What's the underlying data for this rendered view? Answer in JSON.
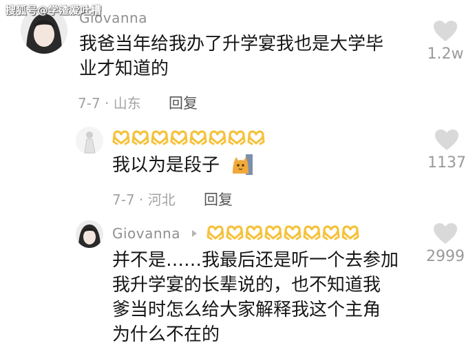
{
  "watermark": "搜狐号@学渣爱吐槽",
  "comments": [
    {
      "username": "Giovanna",
      "lines": [
        "我爸当年给我办了升学宴我也是大学毕",
        "业才知道的"
      ],
      "meta": "7-7 · 山东",
      "reply_label": "回复",
      "like_count": "1.2w",
      "like_icon": "heart-icon"
    },
    {
      "emoji": "heart-hands",
      "emoji_count": 8,
      "lines": [
        "我以为是段子"
      ],
      "sticker": "cat-sticker",
      "meta": "7-7 · 河北",
      "reply_label": "回复",
      "like_count": "1137",
      "like_icon": "heart-icon"
    },
    {
      "username": "Giovanna",
      "emoji": "heart-hands",
      "emoji_count": 8,
      "lines": [
        "并不是……我最后还是听一个去参加",
        "我升学宴的长辈说的，也不知道我",
        "爹当时怎么给大家解释我这个主角",
        "为什么不在的"
      ],
      "like_count": "2999",
      "like_icon": "heart-icon"
    }
  ],
  "colors": {
    "text": "#161616",
    "meta": "#a3a3a3",
    "heart": "#d9d9d9",
    "emoji": "#f5c23c"
  }
}
